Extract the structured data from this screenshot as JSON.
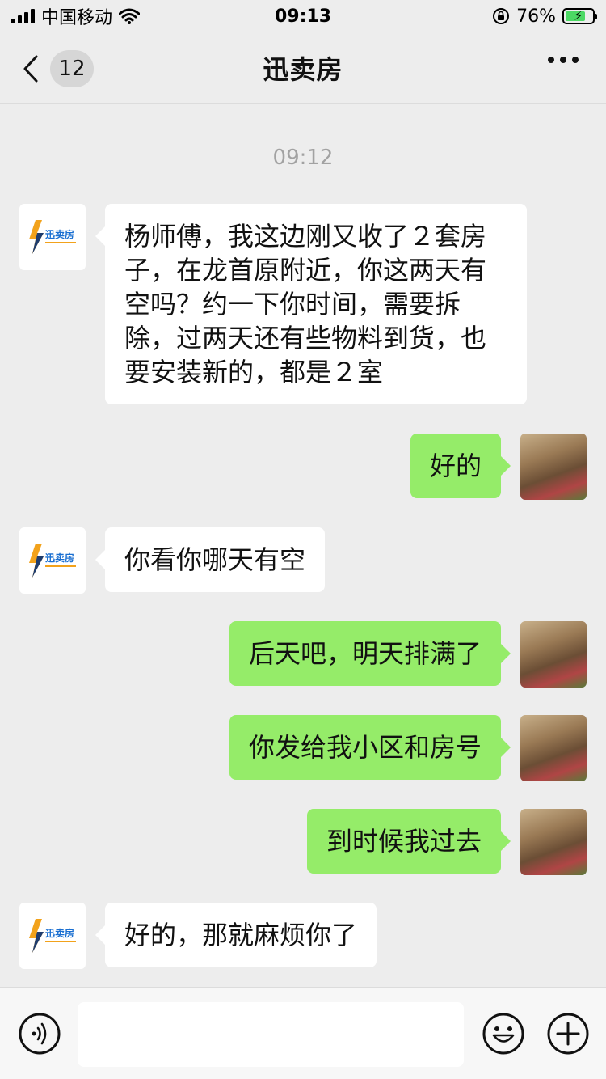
{
  "status_bar": {
    "carrier": "中国移动",
    "time": "09:13",
    "battery_percent": "76%",
    "battery_level": 0.76
  },
  "nav": {
    "unread_count": "12",
    "title": "迅卖房"
  },
  "chat": {
    "timestamp": "09:12",
    "messages": [
      {
        "side": "in",
        "text": "杨师傅，我这边刚又收了２套房子，在龙首原附近，你这两天有空吗？约一下你时间，需要拆除，过两天还有些物料到货，也要安装新的，都是２室"
      },
      {
        "side": "out",
        "text": "好的"
      },
      {
        "side": "in",
        "text": "你看你哪天有空"
      },
      {
        "side": "out",
        "text": "后天吧，明天排满了"
      },
      {
        "side": "out",
        "text": "你发给我小区和房号"
      },
      {
        "side": "out",
        "text": "到时候我过去"
      },
      {
        "side": "in",
        "text": "好的，那就麻烦你了"
      }
    ]
  },
  "brand_logo": {
    "text": "迅卖房",
    "accent": "#1a6fd1",
    "bolt_color": "#f2a21b"
  },
  "colors": {
    "background": "#ededed",
    "incoming_bubble": "#ffffff",
    "outgoing_bubble": "#95ec69"
  },
  "input_bar": {
    "placeholder": "",
    "icons": [
      "voice-icon",
      "emoji-icon",
      "plus-icon"
    ]
  }
}
